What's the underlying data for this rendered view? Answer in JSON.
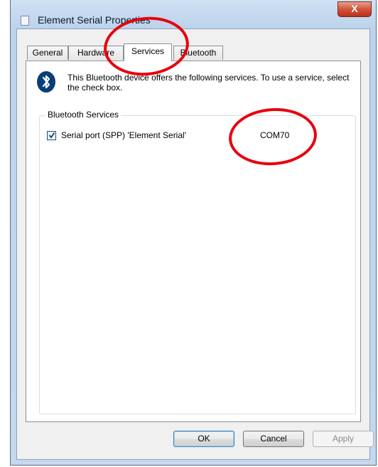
{
  "window": {
    "title": "Element Serial Properties",
    "close_label": "X"
  },
  "tabs": [
    {
      "label": "General",
      "active": false
    },
    {
      "label": "Hardware",
      "active": false
    },
    {
      "label": "Services",
      "active": true
    },
    {
      "label": "Bluetooth",
      "active": false
    }
  ],
  "services": {
    "info_text": "This Bluetooth device offers the following services. To use a service, select the check box.",
    "group_label": "Bluetooth Services",
    "items": [
      {
        "label": "Serial port (SPP) 'Element Serial'",
        "port": "COM70",
        "checked": true
      }
    ]
  },
  "buttons": {
    "ok": "OK",
    "cancel": "Cancel",
    "apply": "Apply"
  },
  "colors": {
    "annotation": "#e8000b",
    "bluetooth_icon": "#0a3e78"
  },
  "icons": [
    "window-icon",
    "close-icon",
    "bluetooth-icon",
    "checkmark-icon"
  ]
}
